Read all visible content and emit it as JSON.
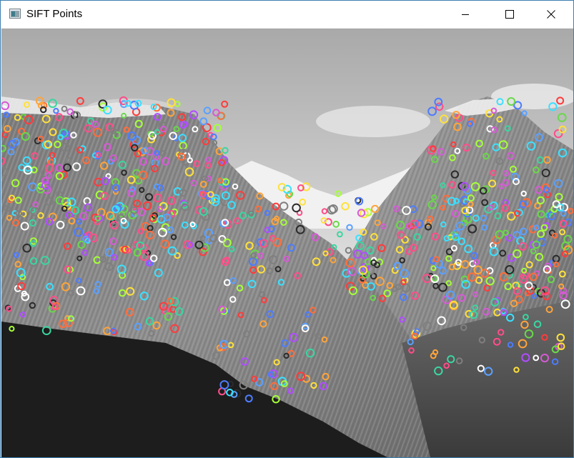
{
  "window": {
    "title": "SIFT Points",
    "controls": {
      "minimize_icon": "minimize-icon",
      "maximize_icon": "maximize-icon",
      "close_icon": "close-icon"
    }
  },
  "image": {
    "description_icon": "image-canvas",
    "keypoint_colors": [
      "#ff4d8a",
      "#6ad84a",
      "#4d7cff",
      "#b04dff",
      "#ffa43b",
      "#3be0ff",
      "#ff3b3b",
      "#a6ff3b",
      "#2b2b2b",
      "#ffffff",
      "#d65ad6",
      "#3bd6a0",
      "#ff6d3b",
      "#7f7f7f",
      "#5aa0ff",
      "#ffe13b"
    ]
  }
}
